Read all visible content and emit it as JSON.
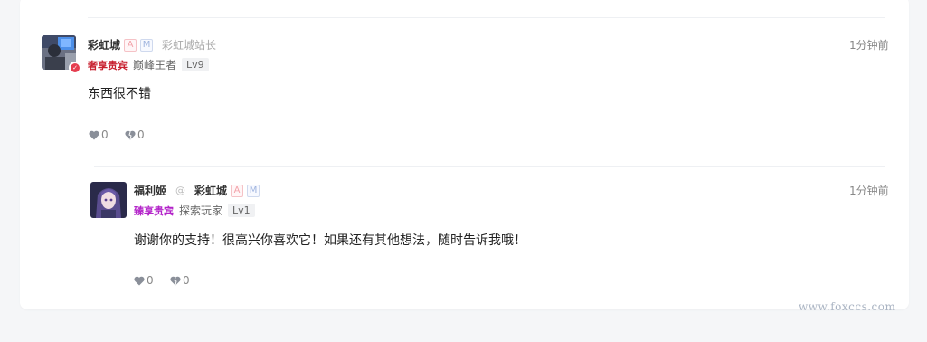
{
  "comments": [
    {
      "user": {
        "name": "彩虹城",
        "badge_a": "A",
        "badge_m": "M",
        "role": "彩虹城站长",
        "avatar": "user-avatar",
        "verified": true
      },
      "vip": {
        "label": "奢享贵宾",
        "color": "#c8202f"
      },
      "title": "巅峰王者",
      "level": "Lv9",
      "time": "1分钟前",
      "content": "东西很不错",
      "likes": "0",
      "dislikes": "0"
    },
    {
      "user": {
        "name": "福利姬",
        "avatar": "anime-girl-avatar"
      },
      "at_symbol": "@",
      "reply_to": {
        "name": "彩虹城",
        "badge_a": "A",
        "badge_m": "M"
      },
      "vip": {
        "label": "臻享贵宾",
        "color": "#b324c9"
      },
      "title": "探索玩家",
      "level": "Lv1",
      "time": "1分钟前",
      "content": "谢谢你的支持！很高兴你喜欢它！如果还有其他想法，随时告诉我哦！",
      "likes": "0",
      "dislikes": "0"
    }
  ],
  "watermark": "www.foxccs.com"
}
